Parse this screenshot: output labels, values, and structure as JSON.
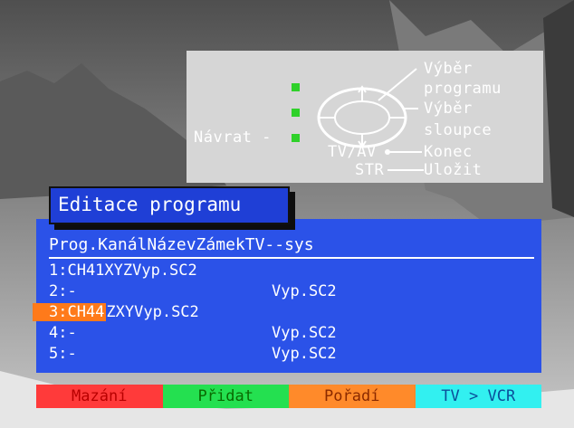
{
  "help": {
    "labels": {
      "vyber": "Výběr",
      "programu": "programu",
      "vyber2": "Výběr",
      "sloupce": "sloupce",
      "navrat": "Návrat -",
      "tvav": "TV/AV",
      "konec": "Konec",
      "str": "STR",
      "ulozit": "Uložit"
    }
  },
  "title": "Editace programu",
  "table": {
    "header": "Prog.KanálNázevZámekTV--sys",
    "rows": [
      {
        "left": "1:CH41XYZVyp.SC2",
        "right": "",
        "highlighted": false
      },
      {
        "left": "2:-",
        "right": "Vyp.SC2",
        "highlighted": false
      },
      {
        "left_hl": "3:CH44",
        "left": "ZXYVyp.SC2",
        "right": "",
        "highlighted": true
      },
      {
        "left": "4:-",
        "right": "Vyp.SC2",
        "highlighted": false
      },
      {
        "left": "5:-",
        "right": "Vyp.SC2",
        "highlighted": false
      }
    ]
  },
  "fkeys": [
    {
      "label": "Mazání",
      "bg": "#ff3a3a",
      "fg": "#b80000"
    },
    {
      "label": "Přidat",
      "bg": "#24e050",
      "fg": "#0a6a00"
    },
    {
      "label": "Pořadí",
      "bg": "#ff8a2a",
      "fg": "#8a2a00"
    },
    {
      "label": "TV > VCR",
      "bg": "#32f0f0",
      "fg": "#0b4f9a"
    }
  ],
  "colors": {
    "panel_blue": "#2b52e8",
    "title_blue": "#1f3fd6",
    "help_gray": "#d6d6d6",
    "highlight_orange": "#ff7a1a"
  }
}
